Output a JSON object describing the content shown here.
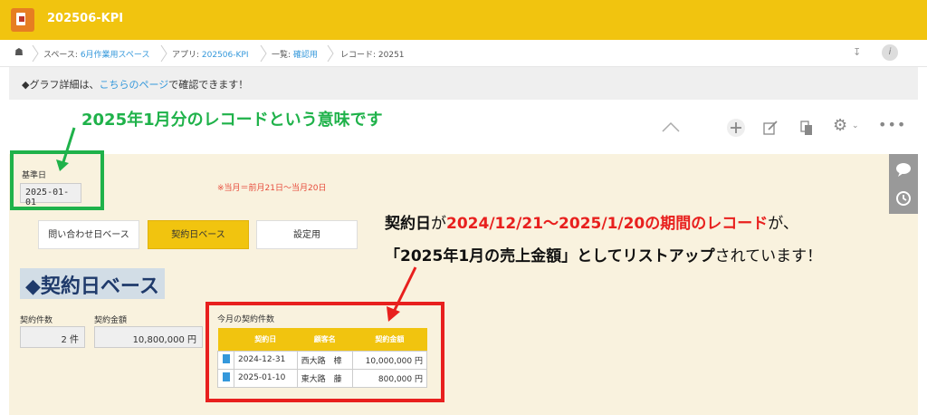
{
  "app": {
    "title": "202506-KPI"
  },
  "breadcrumb": {
    "home_icon": "home-icon",
    "space_prefix": "スペース: ",
    "space": "6月作業用スペース",
    "app_prefix": "アプリ: ",
    "app": "202506-KPI",
    "list_prefix": "一覧: ",
    "list": "確認用",
    "record": "レコード: 20251",
    "pin_icon": "pin-icon",
    "info_icon": "info-icon"
  },
  "notice": {
    "pre": "◆グラフ詳細は、",
    "link": "こちらのページ",
    "post": "で確認できます！"
  },
  "toolbar": {
    "icons": [
      "chevron-up-icon",
      "add-icon",
      "edit-icon",
      "copy-icon",
      "gear-icon",
      "more-icon"
    ]
  },
  "annotations": {
    "green": "2025年1月分のレコードという意味です",
    "line1": {
      "a": "契約日",
      "b": "が",
      "c": "2024/12/21〜2025/1/20の期間のレコード",
      "d": "が、"
    },
    "line2": {
      "a": "「2025年1月の売上金額」としてリストアップ",
      "b": "されています！"
    }
  },
  "form": {
    "base_date_label": "基準日",
    "base_date_value": "2025-01-01",
    "note": "※当月＝前月21日〜当月20日",
    "buttons": [
      "問い合わせ日ベース",
      "契約日ベース",
      "設定用"
    ],
    "section_title": "◆契約日ベース",
    "count_label": "契約件数",
    "count_value": "2 件",
    "amount_label": "契約金額",
    "amount_value": "10,800,000 円",
    "table_label": "今月の契約件数",
    "columns": [
      "契約日",
      "顧客名",
      "契約金額"
    ],
    "rows": [
      {
        "date": "2024-12-31",
        "customer": "西大路　樟",
        "amount": "10,000,000 円"
      },
      {
        "date": "2025-01-10",
        "customer": "東大路　藤",
        "amount": "800,000 円"
      }
    ]
  },
  "colors": {
    "accent": "#f1c40f",
    "green": "#1fb24a",
    "red": "#e8201e",
    "panel": "#f9f2de"
  }
}
